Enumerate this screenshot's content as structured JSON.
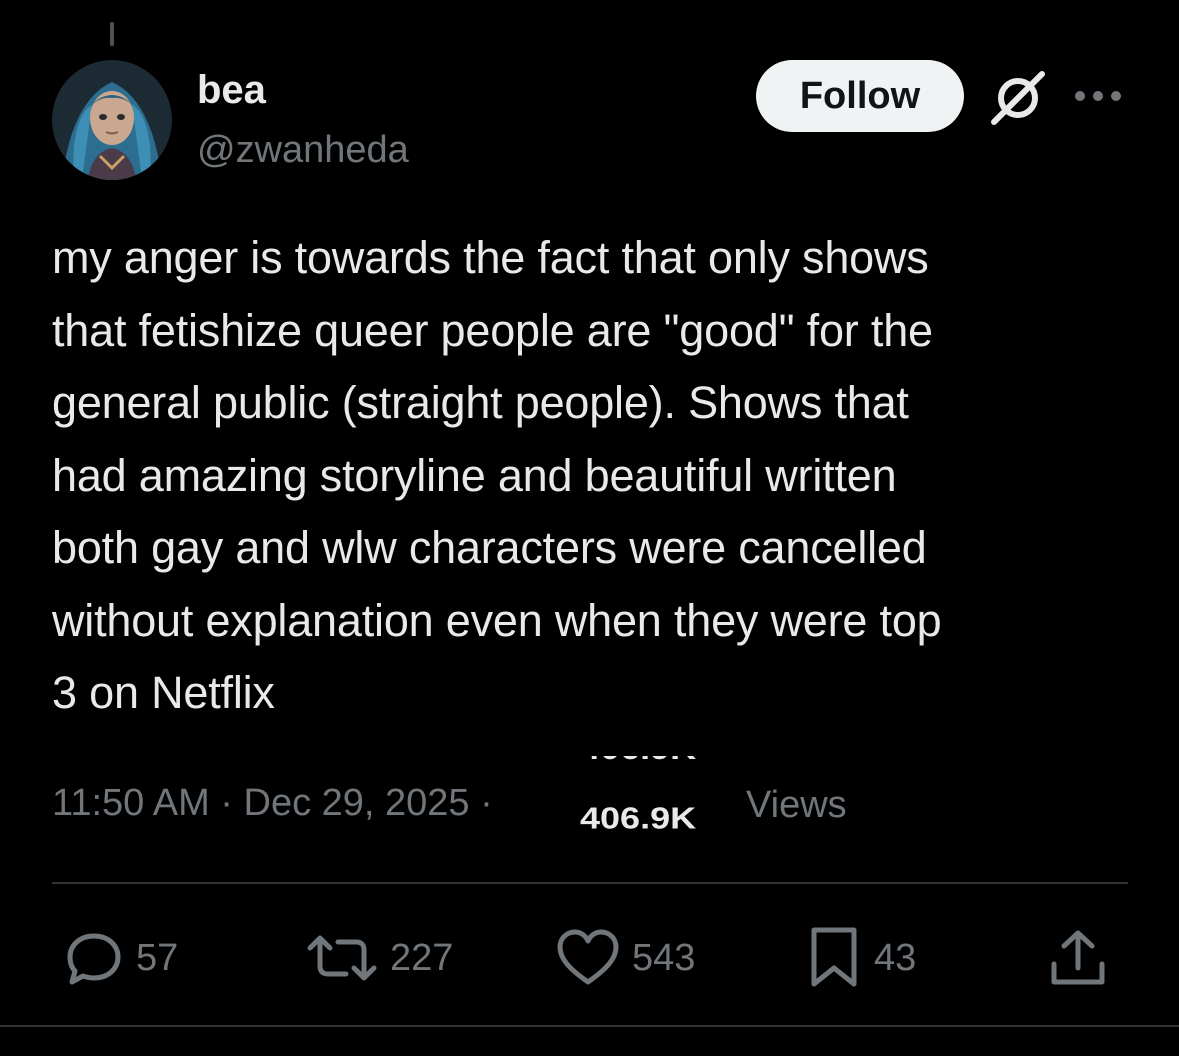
{
  "user": {
    "display_name": "bea",
    "handle": "@zwanheda"
  },
  "follow_label": "Follow",
  "tweet": {
    "text": "my anger is towards the fact that only shows\nthat fetishize queer people are \"good\" for the\ngeneral public (straight people). Shows that\nhad amazing storyline and beautiful written\nboth gay and wlw characters were cancelled\nwithout explanation even when they were top\n3 on Netflix",
    "timestamp": "11:50 AM · Dec 29, 2025 ·",
    "views_count": "406.9K",
    "views_label": "Views"
  },
  "actions": {
    "replies": "57",
    "reposts": "227",
    "likes": "543",
    "bookmarks": "43"
  },
  "icons": {
    "reply": "reply-icon",
    "repost": "repost-icon",
    "like": "heart-icon",
    "bookmark": "bookmark-icon",
    "share": "share-icon",
    "grok": "grok-icon",
    "more": "more-icon"
  },
  "colors": {
    "background": "#000000",
    "text_primary": "#e7e9ea",
    "text_secondary": "#71767b",
    "follow_bg": "#eff3f4",
    "divider": "#2f3336"
  }
}
